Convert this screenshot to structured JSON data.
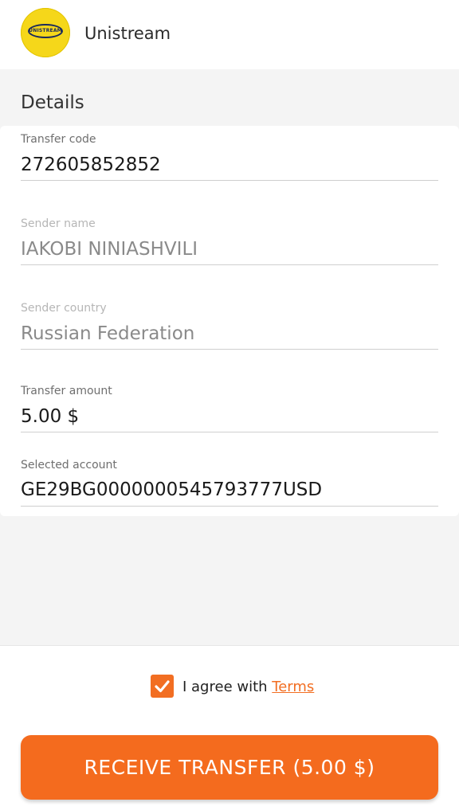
{
  "app": {
    "title": "Unistream",
    "logo_text": "UNISTREAM"
  },
  "details": {
    "section_title": "Details",
    "fields": [
      {
        "label": "Transfer code",
        "value": "272605852852"
      },
      {
        "label": "Sender name",
        "value": "IAKOBI NINIASHVILI"
      },
      {
        "label": "Sender country",
        "value": "Russian Federation"
      },
      {
        "label": "Transfer amount",
        "value": "5.00 $"
      },
      {
        "label": "Selected account",
        "value": "GE29BG0000000545793777USD"
      }
    ]
  },
  "agreement": {
    "checked": true,
    "text": "I agree with ",
    "link_label": "Terms"
  },
  "cta": {
    "label": "RECEIVE TRANSFER (5.00 $)"
  },
  "colors": {
    "accent": "#f46b1e",
    "logo_yellow": "#f5d71a",
    "logo_navy": "#1b2a5c"
  }
}
